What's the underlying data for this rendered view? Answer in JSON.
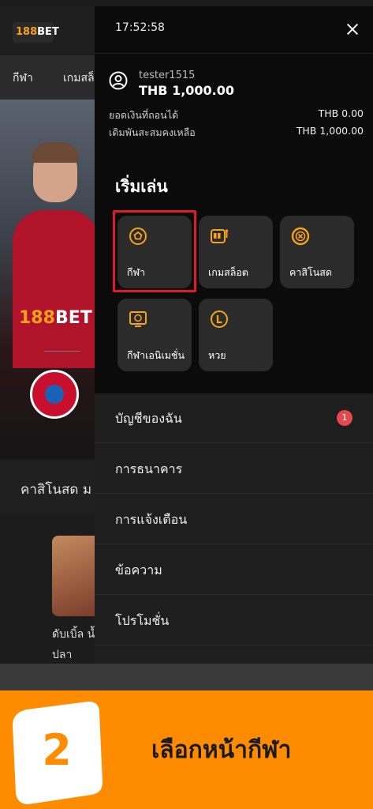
{
  "background": {
    "logo_left": "188",
    "logo_right": "BET",
    "nav": [
      "กีฬา",
      "เกมสล็"
    ],
    "hero_logo_left": "188",
    "hero_logo_right": "BET",
    "section_title": "คาสิโนสด ม",
    "card_title_line1": "ดับเบิ้ล น้ำ",
    "card_title_line2": "ปลา"
  },
  "drawer": {
    "time": "17:52:58",
    "username": "tester1515",
    "balance": "THB 1,000.00",
    "rows": [
      {
        "label": "ยอดเงินที่ถอนได้",
        "value": "THB 0.00"
      },
      {
        "label": "เดิมพันสะสมคงเหลือ",
        "value": "THB 1,000.00"
      }
    ],
    "section_title": "เริ่มเล่น",
    "tiles": [
      {
        "label": "กีฬา",
        "icon": "football-icon"
      },
      {
        "label": "เกมสล็อต",
        "icon": "slot-machine-icon"
      },
      {
        "label": "คาสิโนสด",
        "icon": "casino-chip-icon"
      },
      {
        "label": "กีฬาเอนิเมชั่น",
        "icon": "virtual-sports-icon"
      },
      {
        "label": "หวย",
        "icon": "lottery-icon"
      }
    ],
    "menu": [
      {
        "label": "บัญชีของฉัน",
        "badge": "1"
      },
      {
        "label": "การธนาคาร"
      },
      {
        "label": "การแจ้งเตือน"
      },
      {
        "label": "ข้อความ"
      },
      {
        "label": "โปรโมชั่น"
      }
    ]
  },
  "banner": {
    "step": "2",
    "text": "เลือกหน้ากีฬา"
  },
  "colors": {
    "accent": "#f7a21b",
    "highlight": "#e21a2b",
    "banner": "#ff8c00",
    "badge": "#e5484d"
  }
}
